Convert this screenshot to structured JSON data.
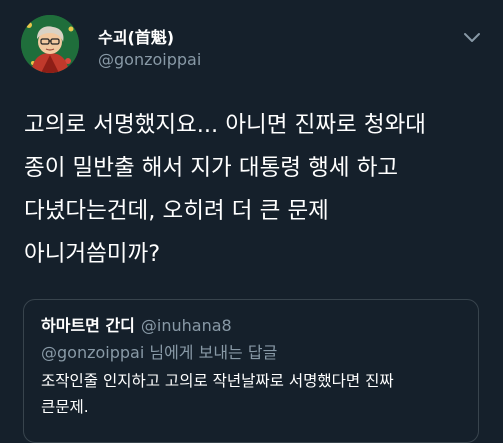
{
  "author": {
    "display_name": "수괴(首魁)",
    "handle": "@gonzoippai"
  },
  "menu_icon": "chevron-down-icon",
  "avatar_icon": "illustrated-avatar",
  "tweet": {
    "lines": [
      "고의로 서명했지요... 아니면 진짜로 청와대",
      "종이 밀반출 해서 지가 대통령 행세 하고",
      "다녔다는건데, 오히려 더 큰 문제",
      "아니거씀미까?"
    ]
  },
  "quote": {
    "author_name": "하마트면 간디",
    "author_handle": "@inuhana8",
    "reply_to_handle": "@gonzoippai",
    "reply_suffix": " 님에게 보내는 답글",
    "lines": [
      "조작인줄 인지하고 고의로 작년날짜로 서명했다면 진짜",
      "큰문제."
    ]
  },
  "colors": {
    "background": "#15202b",
    "text": "#ffffff",
    "secondary_text": "#8899a6",
    "border": "#38444d"
  }
}
